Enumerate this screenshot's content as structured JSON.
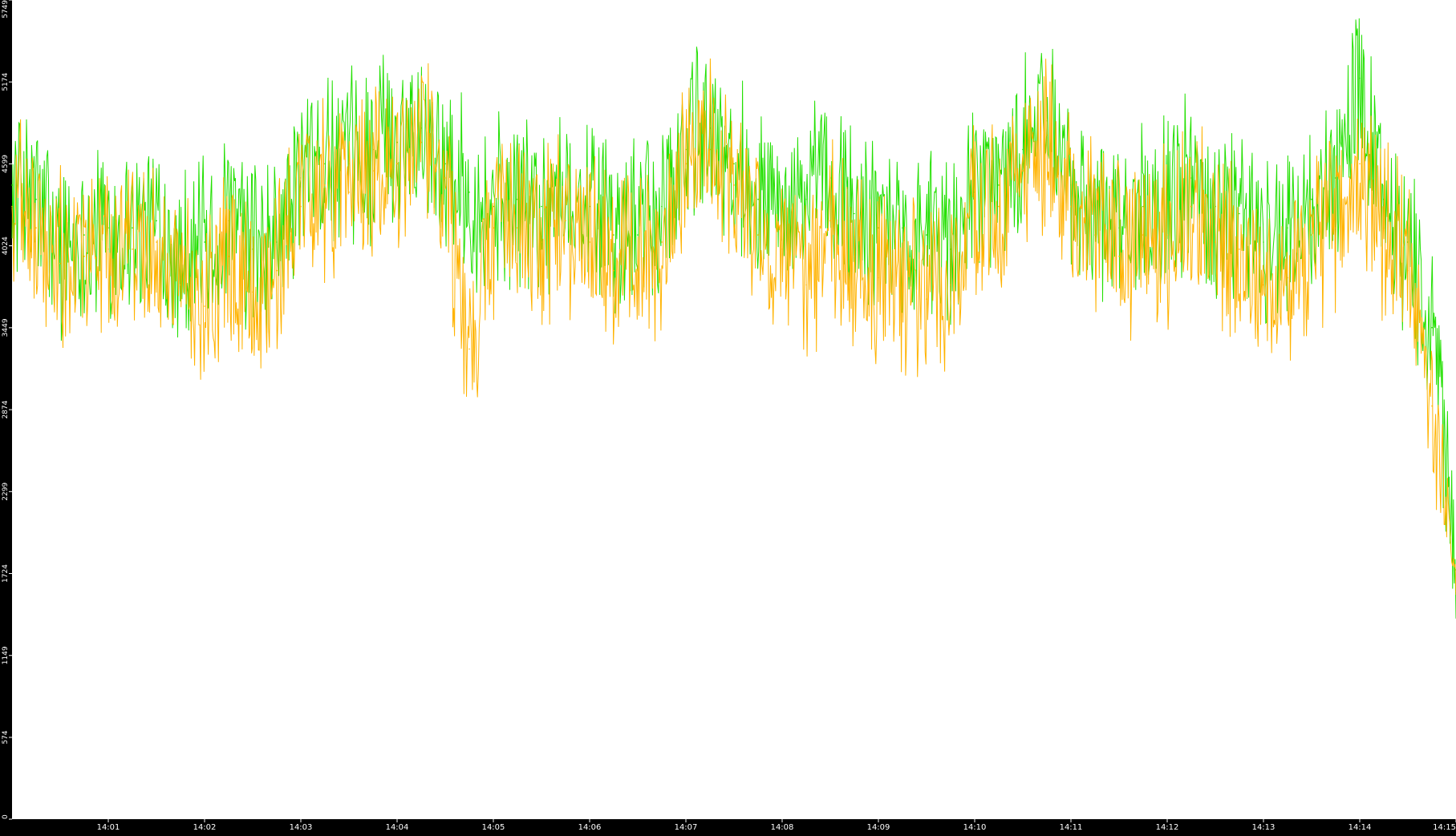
{
  "chart_data": {
    "type": "line",
    "title": "",
    "xlabel": "",
    "ylabel": "",
    "ylim": [
      0,
      5749
    ],
    "y_ticks": [
      0,
      574,
      1149,
      1724,
      2299,
      2874,
      3449,
      4024,
      4599,
      5174,
      5749
    ],
    "x_ticks": [
      "14:01",
      "14:02",
      "14:03",
      "14:04",
      "14:05",
      "14:06",
      "14:07",
      "14:08",
      "14:09",
      "14:10",
      "14:11",
      "14:12",
      "14:13",
      "14:14",
      "14:15"
    ],
    "x_tick_minutes": [
      1,
      2,
      3,
      4,
      5,
      6,
      7,
      8,
      9,
      10,
      11,
      12,
      13,
      14,
      15
    ],
    "xlim_minutes": [
      0.0,
      15.0
    ],
    "grid": false,
    "legend": "none",
    "colors": {
      "background_plot": "#ffffff",
      "background_frame": "#000000",
      "axis_text": "#ffffff"
    },
    "series": [
      {
        "color": "#22e000",
        "x": [
          0.0,
          0.25,
          0.5,
          0.75,
          1.0,
          1.25,
          1.5,
          1.75,
          2.0,
          2.25,
          2.5,
          2.75,
          3.0,
          3.25,
          3.5,
          3.75,
          4.0,
          4.25,
          4.5,
          4.75,
          5.0,
          5.25,
          5.5,
          5.75,
          6.0,
          6.25,
          6.5,
          6.75,
          7.0,
          7.25,
          7.5,
          7.75,
          8.0,
          8.25,
          8.5,
          8.75,
          9.0,
          9.25,
          9.5,
          9.75,
          10.0,
          10.25,
          10.5,
          10.75,
          11.0,
          11.25,
          11.5,
          11.75,
          12.0,
          12.25,
          12.5,
          12.75,
          13.0,
          13.25,
          13.5,
          13.75,
          14.0,
          14.25,
          14.5,
          14.75,
          15.0
        ],
        "values": [
          4450,
          4350,
          4050,
          4100,
          4150,
          4150,
          4200,
          4000,
          4050,
          4200,
          4000,
          4050,
          4500,
          4600,
          4600,
          4700,
          4750,
          4850,
          4600,
          4400,
          4300,
          4350,
          4300,
          4400,
          4300,
          4100,
          4100,
          4300,
          4700,
          4850,
          4600,
          4350,
          4300,
          4350,
          4500,
          4250,
          4150,
          4150,
          4100,
          4000,
          4400,
          4450,
          4700,
          4900,
          4450,
          4300,
          4150,
          4300,
          4350,
          4500,
          4300,
          4250,
          4050,
          4150,
          4350,
          4500,
          5200,
          4350,
          4050,
          3450,
          1750
        ]
      },
      {
        "color": "#ffb300",
        "x": [
          0.0,
          0.25,
          0.5,
          0.75,
          1.0,
          1.25,
          1.5,
          1.75,
          2.0,
          2.25,
          2.5,
          2.75,
          3.0,
          3.25,
          3.5,
          3.75,
          4.0,
          4.25,
          4.5,
          4.75,
          5.0,
          5.25,
          5.5,
          5.75,
          6.0,
          6.25,
          6.5,
          6.75,
          7.0,
          7.25,
          7.5,
          7.75,
          8.0,
          8.25,
          8.5,
          8.75,
          9.0,
          9.25,
          9.5,
          9.75,
          10.0,
          10.25,
          10.5,
          10.75,
          11.0,
          11.25,
          11.5,
          11.75,
          12.0,
          12.25,
          12.5,
          12.75,
          13.0,
          13.25,
          13.5,
          13.75,
          14.0,
          14.25,
          14.5,
          14.75,
          15.0
        ],
        "values": [
          4300,
          4150,
          3900,
          3950,
          4000,
          4000,
          4050,
          3750,
          3600,
          3950,
          3700,
          3850,
          4300,
          4450,
          4400,
          4550,
          4600,
          4750,
          4500,
          3300,
          4150,
          4150,
          4050,
          4200,
          4050,
          3850,
          3850,
          4050,
          4600,
          4700,
          4450,
          4100,
          4000,
          3750,
          4200,
          3950,
          3800,
          3750,
          3650,
          3750,
          4250,
          4300,
          4550,
          4800,
          4300,
          4100,
          3950,
          4100,
          4100,
          4300,
          4050,
          4000,
          3750,
          3800,
          4100,
          4150,
          4600,
          4150,
          3850,
          2900,
          1600
        ]
      }
    ]
  }
}
